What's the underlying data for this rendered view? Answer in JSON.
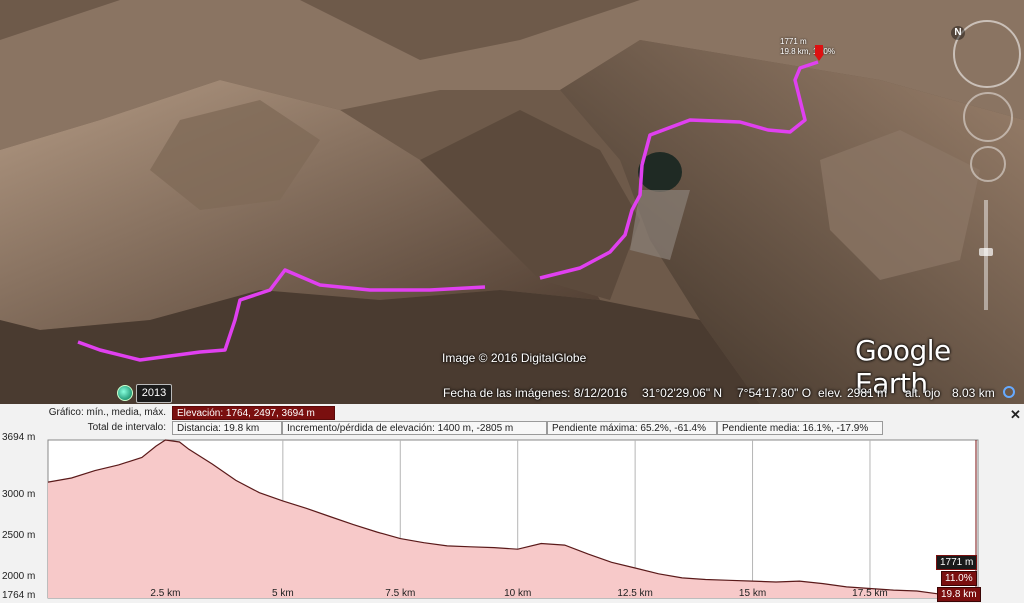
{
  "globe": {
    "copyright": "Image © 2016 DigitalGlobe",
    "logo": "Google Earth",
    "history_year": "2013",
    "compass_label": "N",
    "marker_label_line1": "1771 m",
    "marker_label_line2": "19.8 km, 11.0%",
    "status": {
      "imagery_date": "Fecha de las imágenes: 8/12/2016",
      "latitude": "31°02'29.06\" N",
      "longitude": "7°54'17.80\" O",
      "elev_label": "elev.",
      "elev_value": "2981 m",
      "eye_label": "alt. ojo",
      "eye_value": "8.03 km"
    },
    "icons": [
      "history-clock-icon",
      "compass-icon",
      "look-control-icon",
      "move-control-icon",
      "zoom-slider-icon",
      "loading-icon"
    ],
    "track_color": "#e040f0"
  },
  "profile": {
    "row1": {
      "label": "Gráfico: mín., media, máx.",
      "elevation": "Elevación: 1764, 2497, 3694 m"
    },
    "row2": {
      "label": "Total de intervalo:",
      "distance": "Distancia: 19.8 km",
      "gain_loss": "Incremento/pérdida de elevación: 1400 m, -2805 m",
      "max_slope": "Pendiente máxima: 65.2%, -61.4%",
      "avg_slope": "Pendiente media: 16.1%, -17.9%"
    },
    "close": "✕",
    "colors": {
      "selected": "#7a0f0f",
      "fill": "#f7c9c9",
      "line": "#5a1a1a"
    }
  },
  "chart_data": {
    "type": "area",
    "y_ticks": [
      "3694 m",
      "3000 m",
      "2500 m",
      "2000 m",
      "1764 m"
    ],
    "y_tick_values": [
      3694,
      3000,
      2500,
      2000,
      1764
    ],
    "x_ticks": [
      "2.5 km",
      "5 km",
      "7.5 km",
      "10 km",
      "12.5 km",
      "15 km",
      "17.5 km"
    ],
    "x_tick_values": [
      2.5,
      5,
      7.5,
      10,
      12.5,
      15,
      17.5
    ],
    "xlim": [
      0,
      19.8
    ],
    "ylim": [
      1764,
      3694
    ],
    "grid": true,
    "end_label_elev": "1771 m",
    "end_label_slope": "11.0%",
    "end_label_dist": "19.8 km",
    "x": [
      0,
      0.5,
      1,
      1.5,
      2,
      2.3,
      2.5,
      2.8,
      3,
      3.5,
      4,
      4.5,
      5,
      5.5,
      6,
      6.5,
      7,
      7.5,
      8,
      8.5,
      9,
      9.5,
      10,
      10.5,
      11,
      11.5,
      12,
      12.5,
      13,
      13.5,
      14,
      14.5,
      15,
      15.5,
      16,
      16.5,
      17,
      17.5,
      18,
      18.5,
      19,
      19.8
    ],
    "y": [
      3180,
      3230,
      3320,
      3390,
      3480,
      3620,
      3694,
      3670,
      3580,
      3400,
      3200,
      3050,
      2950,
      2860,
      2760,
      2660,
      2570,
      2490,
      2440,
      2400,
      2390,
      2380,
      2360,
      2430,
      2410,
      2300,
      2200,
      2130,
      2060,
      2010,
      1990,
      1980,
      1970,
      1960,
      1970,
      1940,
      1900,
      1880,
      1860,
      1850,
      1810,
      1771
    ]
  }
}
